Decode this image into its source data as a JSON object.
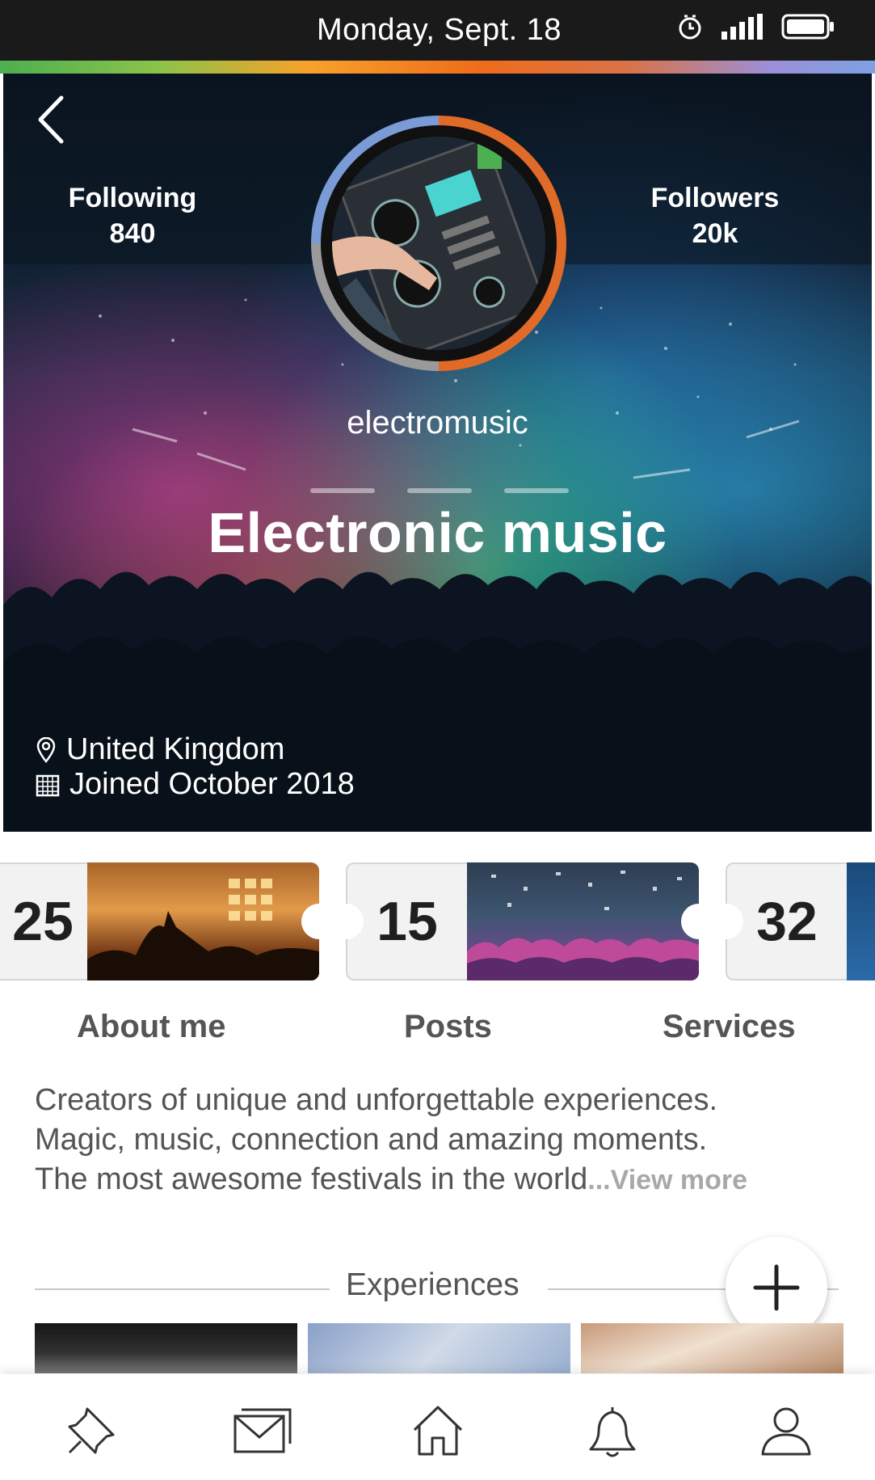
{
  "status_bar": {
    "date": "Monday, Sept. 18"
  },
  "profile": {
    "following_label": "Following",
    "following_count": "840",
    "followers_label": "Followers",
    "followers_count": "20k",
    "username": "electromusic",
    "title": "Electronic music",
    "location": "United Kingdom",
    "joined": "Joined October 2018"
  },
  "tickets": [
    {
      "count": "25",
      "label": "About me"
    },
    {
      "count": "15",
      "label": "Posts"
    },
    {
      "count": "32",
      "label": "Services"
    }
  ],
  "bio": {
    "line1": "Creators of unique and unforgettable experiences.",
    "line2": "Magic, music, connection and amazing moments.",
    "line3": "The most awesome festivals in the world",
    "ellipsis": "...",
    "view_more": "View more"
  },
  "experiences": {
    "title": "Experiences"
  },
  "bottom_nav": {
    "items": [
      "pin-icon",
      "mail-icon",
      "home-icon",
      "bell-icon",
      "profile-icon"
    ]
  },
  "colors": {
    "ring_orange": "#e06a28",
    "ring_blue": "#7a9bd6",
    "ring_gray": "#9a9a9a"
  }
}
